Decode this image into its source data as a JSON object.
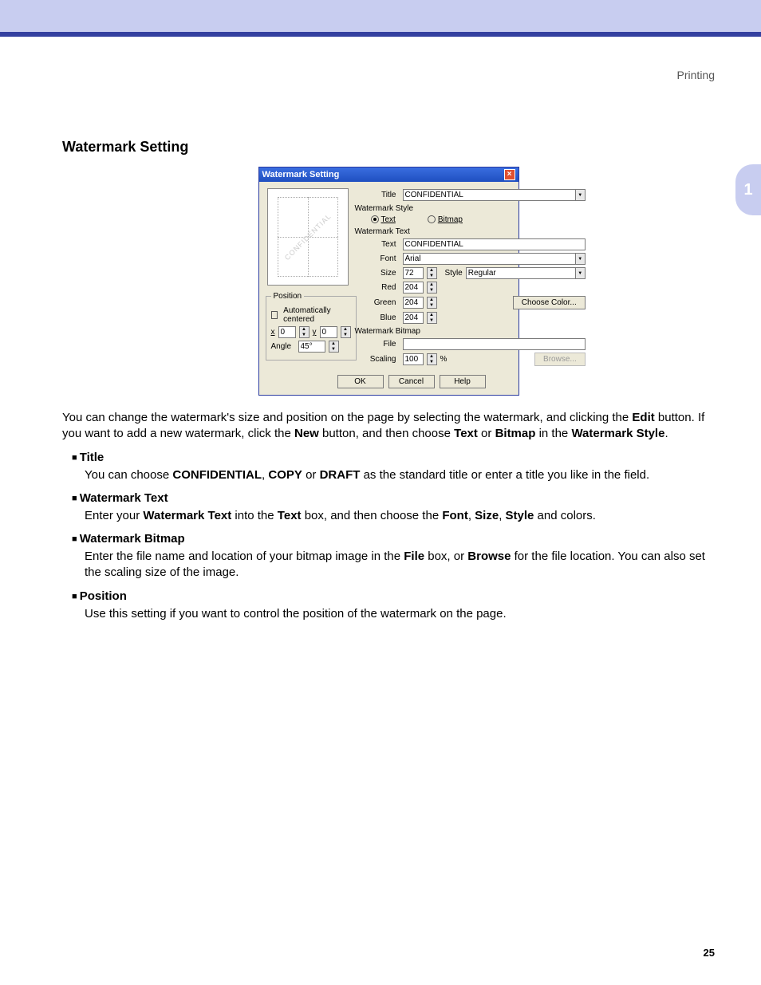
{
  "header": {
    "section": "Printing"
  },
  "sideTab": "1",
  "sectionTitle": "Watermark Setting",
  "dialog": {
    "title": "Watermark Setting",
    "titleField": {
      "label": "Title",
      "value": "CONFIDENTIAL"
    },
    "styleGroup": {
      "label": "Watermark Style",
      "text": "Text",
      "bitmap": "Bitmap"
    },
    "textGroup": {
      "label": "Watermark Text",
      "text": {
        "label": "Text",
        "value": "CONFIDENTIAL"
      },
      "font": {
        "label": "Font",
        "value": "Arial"
      },
      "size": {
        "label": "Size",
        "value": "72"
      },
      "style": {
        "label": "Style",
        "value": "Regular"
      },
      "red": {
        "label": "Red",
        "value": "204"
      },
      "green": {
        "label": "Green",
        "value": "204"
      },
      "blue": {
        "label": "Blue",
        "value": "204"
      },
      "chooseColor": "Choose Color..."
    },
    "bitmapGroup": {
      "label": "Watermark Bitmap",
      "file": {
        "label": "File",
        "value": ""
      },
      "scaling": {
        "label": "Scaling",
        "value": "100",
        "unit": "%"
      },
      "browse": "Browse..."
    },
    "positionGroup": {
      "legend": "Position",
      "auto": "Automatically centered",
      "x": {
        "label": "x",
        "value": "0"
      },
      "y": {
        "label": "y",
        "value": "0"
      },
      "angle": {
        "label": "Angle",
        "value": "45°"
      }
    },
    "previewText": "CONFIDENTIAL",
    "buttons": {
      "ok": "OK",
      "cancel": "Cancel",
      "help": "Help"
    }
  },
  "para1_a": "You can change the watermark's size and position on the page by selecting the watermark, and clicking the ",
  "para1_edit": "Edit",
  "para1_b": " button. If you want to add a new watermark, click the ",
  "para1_new": "New",
  "para1_c": " button, and then choose ",
  "para1_text": "Text",
  "para1_d": " or ",
  "para1_bitmap": "Bitmap",
  "para1_e": " in the ",
  "para1_ws": "Watermark Style",
  "para1_f": ".",
  "b_title": "Title",
  "b_title_a": "You can choose ",
  "b_title_c": "CONFIDENTIAL",
  "b_title_b": ", ",
  "b_title_copy": "COPY",
  "b_title_d": " or ",
  "b_title_draft": "DRAFT",
  "b_title_e": " as the standard title or enter a title you like in the field.",
  "b_wt": "Watermark Text",
  "b_wt_a": "Enter your ",
  "b_wt_b": "Watermark Text",
  "b_wt_c": " into the ",
  "b_wt_textbox": "Text",
  "b_wt_d": " box, and then choose the ",
  "b_wt_font": "Font",
  "b_wt_e": ", ",
  "b_wt_size": "Size",
  "b_wt_f": ", ",
  "b_wt_style": "Style",
  "b_wt_g": " and colors.",
  "b_wb": "Watermark Bitmap",
  "b_wb_a": "Enter the file name and location of your bitmap image in the ",
  "b_wb_file": "File",
  "b_wb_b": " box, or ",
  "b_wb_browse": "Browse",
  "b_wb_c": " for the file location. You can also set the scaling size of the image.",
  "b_pos": "Position",
  "b_pos_a": "Use this setting if you want to control the position of the watermark on the page.",
  "pageNumber": "25"
}
